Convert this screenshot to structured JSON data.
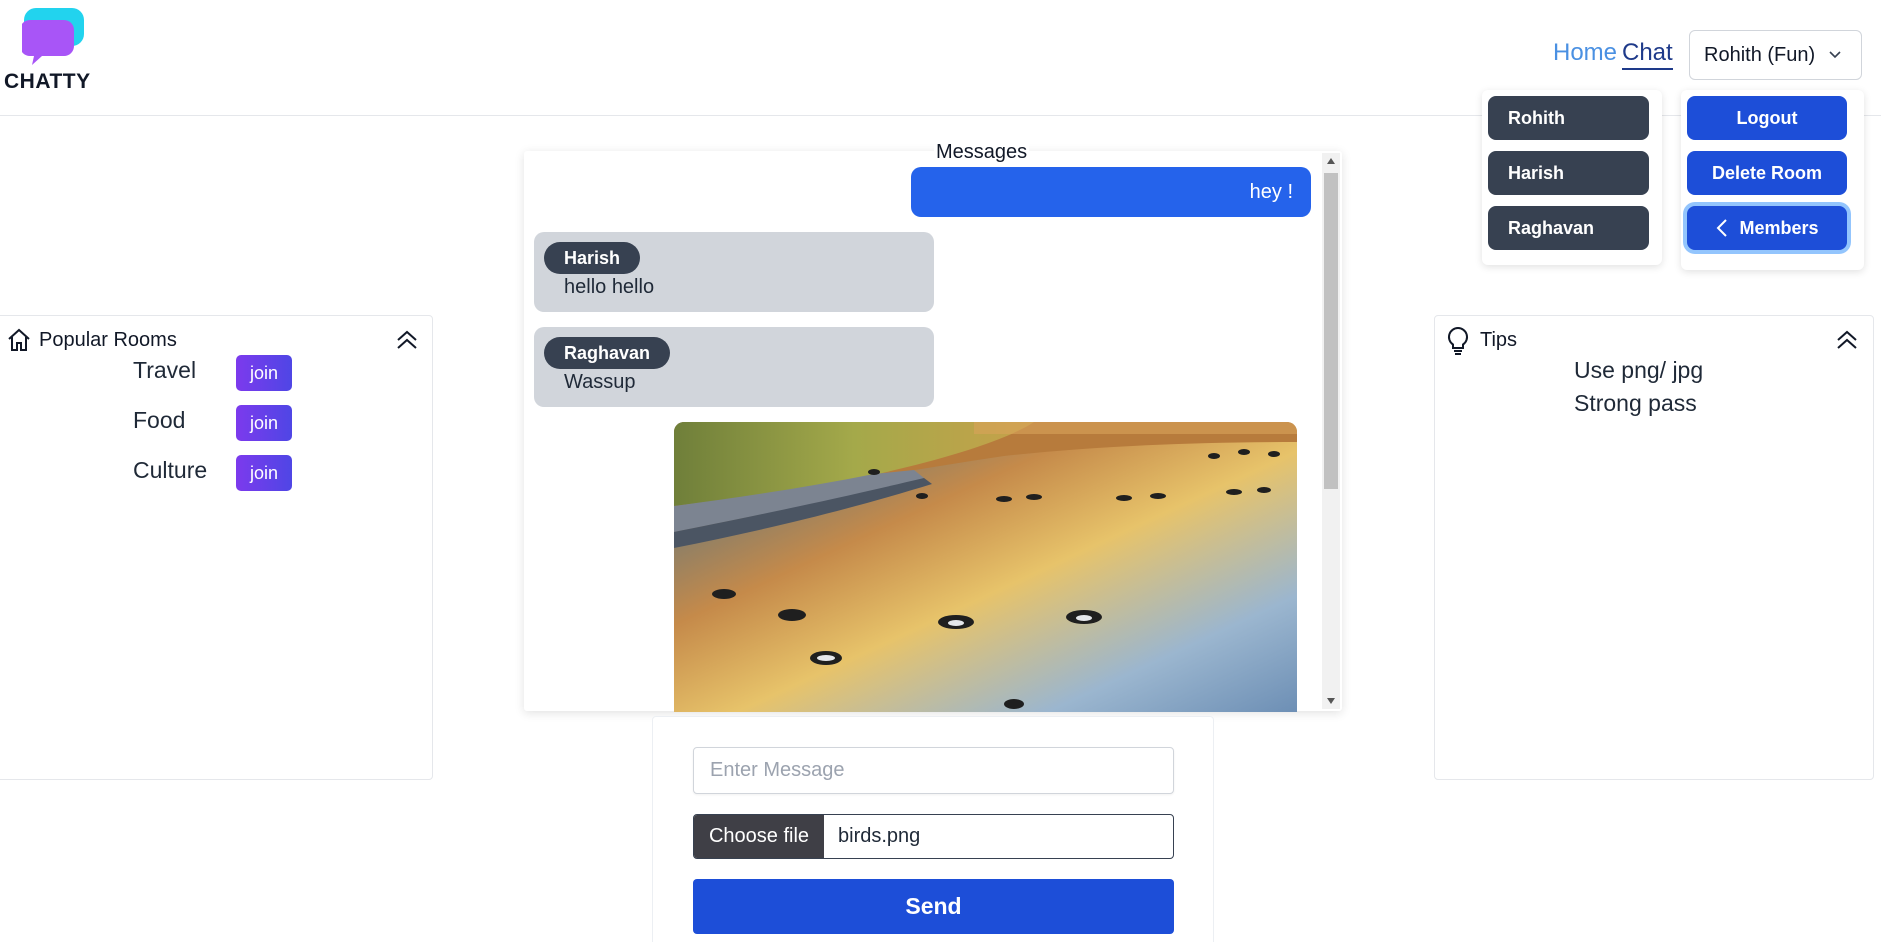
{
  "brand": {
    "name": "CHATTY"
  },
  "nav": {
    "home": "Home",
    "chat": "Chat",
    "user_select": "Rohith (Fun)"
  },
  "members": [
    "Rohith",
    "Harish",
    "Raghavan"
  ],
  "actions": {
    "logout": "Logout",
    "delete_room": "Delete Room",
    "members": "Members"
  },
  "popular_rooms": {
    "title": "Popular Rooms",
    "join_label": "join",
    "rooms": [
      "Travel",
      "Food",
      "Culture"
    ]
  },
  "tips": {
    "title": "Tips",
    "items": [
      "Use png/ jpg",
      "Strong pass"
    ]
  },
  "messages": {
    "title": "Messages",
    "self": {
      "text": "hey !"
    },
    "items": [
      {
        "sender": "Harish",
        "text": "hello hello"
      },
      {
        "sender": "Raghavan",
        "text": "Wassup"
      }
    ]
  },
  "composer": {
    "placeholder": "Enter Message",
    "file_button": "Choose file",
    "file_name": "birds.png",
    "send": "Send"
  },
  "colors": {
    "primary": "#1d4ed8",
    "dark": "#374151",
    "join": "#6d28d9",
    "self_bubble": "#2563eb",
    "other_bubble": "#d1d5db"
  }
}
